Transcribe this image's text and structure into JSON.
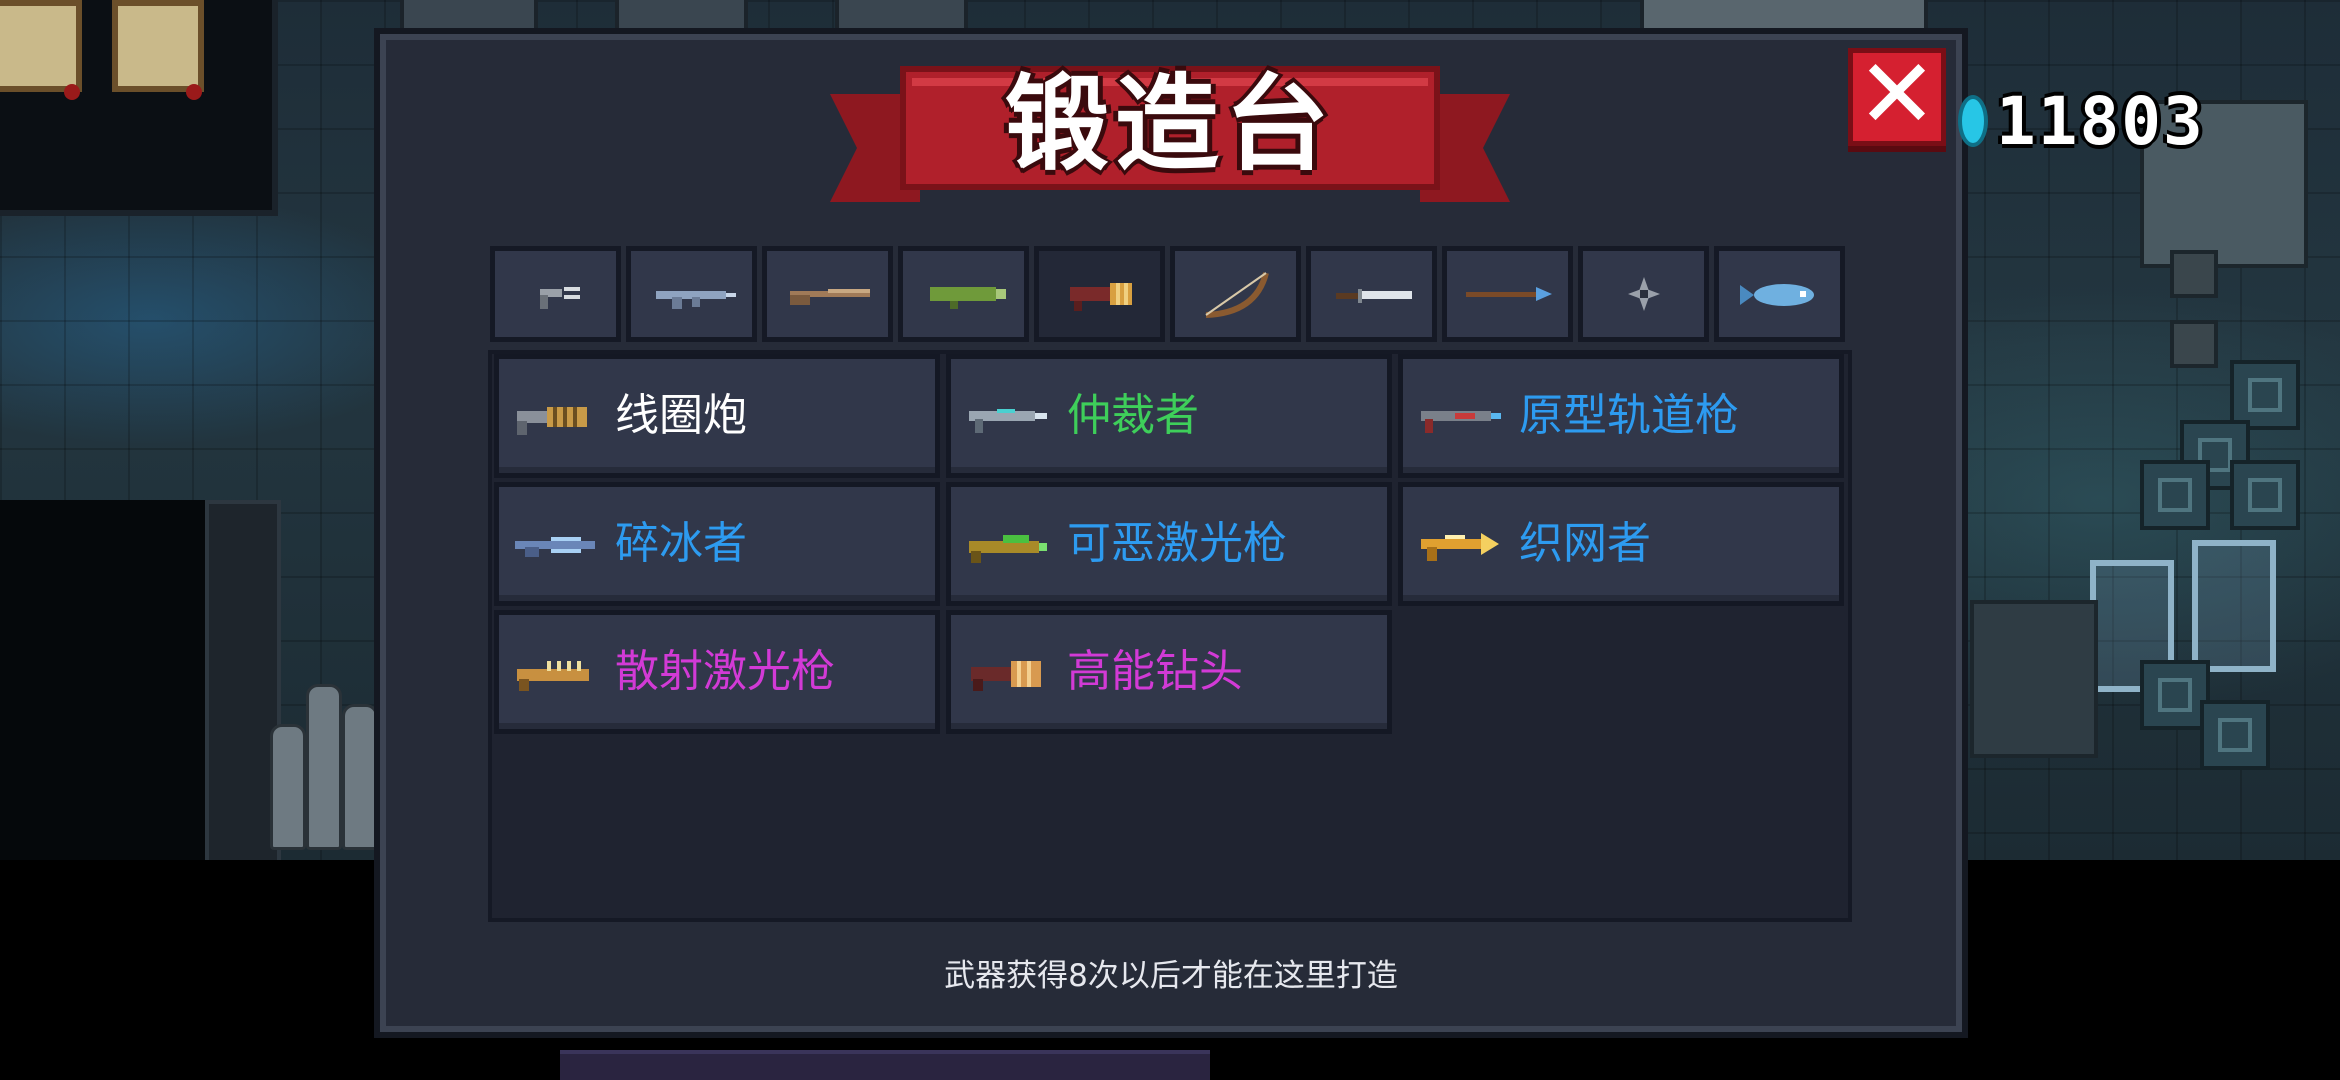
{
  "title": "锻造台",
  "coins": {
    "value": "11803",
    "icon": "gem-coin-icon"
  },
  "close_icon": "close-icon",
  "tabs": [
    {
      "icon": "pistol-icon",
      "active": false
    },
    {
      "icon": "rifle-icon",
      "active": false
    },
    {
      "icon": "shotgun-icon",
      "active": false
    },
    {
      "icon": "launcher-icon",
      "active": false
    },
    {
      "icon": "laser-cannon-icon",
      "active": true
    },
    {
      "icon": "bow-icon",
      "active": false
    },
    {
      "icon": "sword-icon",
      "active": false
    },
    {
      "icon": "spear-icon",
      "active": false
    },
    {
      "icon": "throwing-star-icon",
      "active": false
    },
    {
      "icon": "fish-weapon-icon",
      "active": false
    }
  ],
  "weapons": [
    {
      "name": "线圈炮",
      "color": "#ffffff",
      "icon": "coil-cannon-icon"
    },
    {
      "name": "仲裁者",
      "color": "#3ecf5a",
      "icon": "arbiter-icon"
    },
    {
      "name": "原型轨道枪",
      "color": "#2d9bf0",
      "icon": "prototype-railgun-icon"
    },
    {
      "name": "碎冰者",
      "color": "#2d9bf0",
      "icon": "ice-breaker-icon"
    },
    {
      "name": "可恶激光枪",
      "color": "#2d9bf0",
      "icon": "nasty-laser-gun-icon"
    },
    {
      "name": "织网者",
      "color": "#2d9bf0",
      "icon": "web-weaver-icon"
    },
    {
      "name": "散射激光枪",
      "color": "#d23ad6",
      "icon": "scatter-laser-gun-icon"
    },
    {
      "name": "高能钻头",
      "color": "#d23ad6",
      "icon": "high-energy-drill-icon"
    }
  ],
  "footer_note": "武器获得8次以后才能在这里打造"
}
